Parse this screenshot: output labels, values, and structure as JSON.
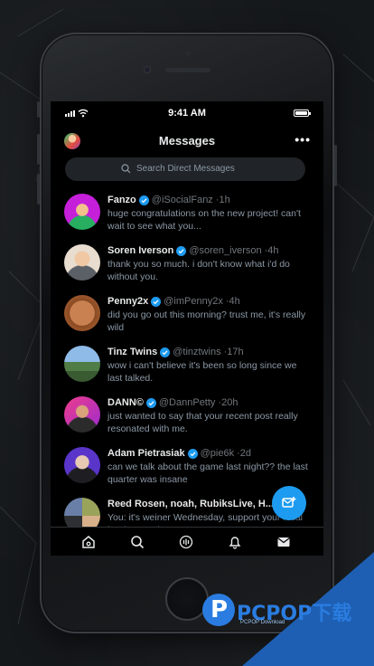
{
  "status_bar": {
    "time": "9:41 AM"
  },
  "header": {
    "title": "Messages",
    "more_icon": "more-horizontal-icon"
  },
  "search": {
    "placeholder": "Search Direct Messages"
  },
  "conversations": [
    {
      "name": "Fanzo",
      "verified": true,
      "handle": "@iSocialFanz",
      "time": "1h",
      "message": "huge congratulations on the new project! can't wait to see what you...",
      "avatar_color": "#c51fd9"
    },
    {
      "name": "Soren Iverson",
      "verified": true,
      "handle": "@soren_iverson",
      "time": "4h",
      "message": "thank you so much. i don't know what i'd do without you.",
      "avatar_color": "#d9c4a8"
    },
    {
      "name": "Penny2x",
      "verified": true,
      "handle": "@imPenny2x",
      "time": "4h",
      "message": "did you go out this morning? trust me, it's really wild",
      "avatar_color": "#b06a3b"
    },
    {
      "name": "Tinz Twins",
      "verified": true,
      "handle": "@tinztwins",
      "time": "17h",
      "message": "wow i can't believe it's been so long since we last talked.",
      "avatar_color": "#6aa0d8"
    },
    {
      "name": "DANN©",
      "verified": true,
      "handle": "@DannPetty",
      "time": "20h",
      "message": "just wanted to say that your recent post really resonated with me.",
      "avatar_color": "#d9317a"
    },
    {
      "name": "Adam Pietrasiak",
      "verified": true,
      "handle": "@pie6k",
      "time": "2d",
      "message": "can we talk about the game last night?? the last quarter was insane",
      "avatar_color": "#5a35c9"
    },
    {
      "name": "Reed Rosen, noah, RubiksLive, H...",
      "verified": false,
      "handle": "",
      "time": "",
      "message": "You: it's weiner Wednesday, support your local hotdog vendor!",
      "avatar_color": "#9aa35a"
    }
  ],
  "tabs": [
    {
      "name": "home",
      "icon": "home-icon"
    },
    {
      "name": "search",
      "icon": "search-icon"
    },
    {
      "name": "spaces",
      "icon": "spaces-icon"
    },
    {
      "name": "notifications",
      "icon": "bell-icon"
    },
    {
      "name": "messages",
      "icon": "mail-icon"
    }
  ],
  "compose_button": {
    "icon": "new-message-icon"
  },
  "watermark": {
    "text": "PCPOP下载",
    "subtext": "PCPOP Download"
  },
  "colors": {
    "accent": "#1d9bf0",
    "background": "#000000",
    "watermark": "#1e5fb3"
  }
}
